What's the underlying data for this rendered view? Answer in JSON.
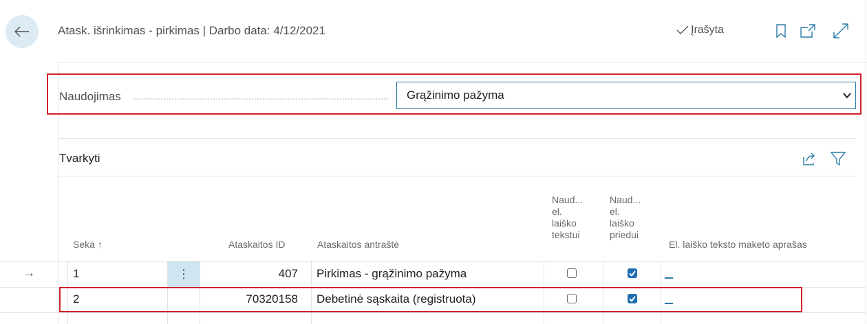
{
  "header": {
    "title": "Atask. išrinkimas - pirkimas | Darbo data: 4/12/2021",
    "saved_label": "Įrašyta",
    "icons": [
      "back-arrow-icon",
      "check-icon",
      "bookmark-icon",
      "open-new-window-icon",
      "expand-icon"
    ]
  },
  "usage": {
    "label": "Naudojimas",
    "selected": "Grąžinimo pažyma"
  },
  "section": {
    "title": "Tvarkyti",
    "icons": [
      "share-icon",
      "filter-icon"
    ]
  },
  "table": {
    "columns": {
      "seq": "Seka",
      "seq_sort": "↑",
      "report_id": "Ataskaitos ID",
      "report_caption": "Ataskaitos antraštė",
      "use_body_l1": "Naud...",
      "use_body_l2": "el.",
      "use_body_l3": "laiško",
      "use_body_l4": "tekstui",
      "use_att_l1": "Naud...",
      "use_att_l2": "el.",
      "use_att_l3": "laiško",
      "use_att_l4": "priedui",
      "email_layout": "El. laiško teksto maketo aprašas"
    },
    "rows": [
      {
        "arrow": "→",
        "menu": "⋮",
        "seq": "1",
        "report_id": "407",
        "caption": "Pirkimas - grąžinimo pažyma",
        "use_body": false,
        "use_attachment": true
      },
      {
        "seq": "2",
        "report_id": "70320158",
        "caption": "Debetinė sąskaita (registruota)",
        "use_body": false,
        "use_attachment": true
      }
    ]
  },
  "colors": {
    "accent": "#1f6fb2",
    "highlight_border": "#d21f2b",
    "selected_cell": "#cfe6f0"
  }
}
